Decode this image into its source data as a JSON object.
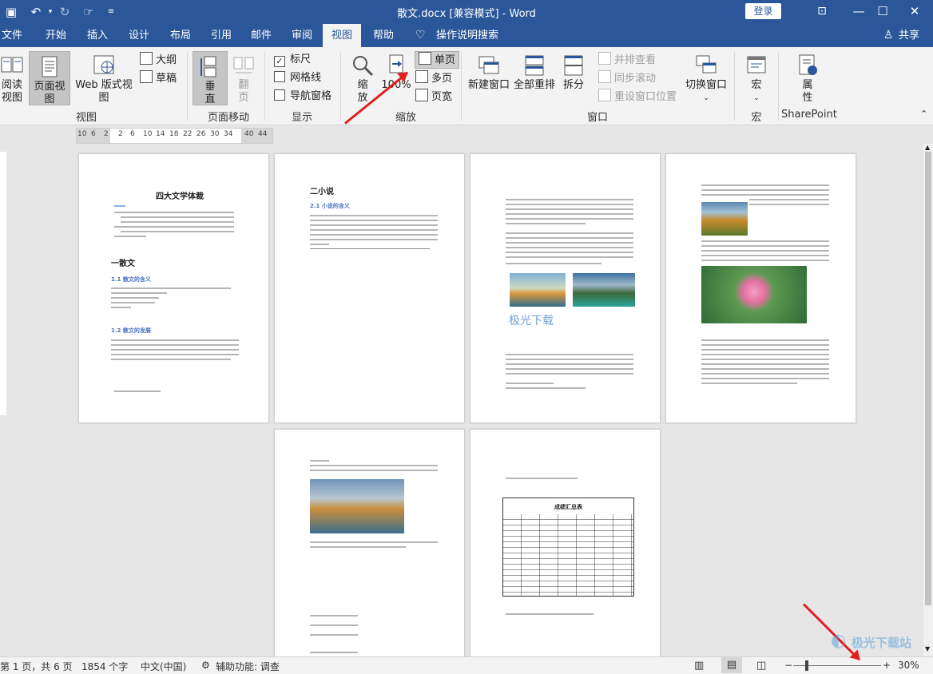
{
  "title_bar": {
    "document_title": "散文.docx [兼容模式]  -  Word",
    "login_label": "登录"
  },
  "tabs": [
    "文件",
    "开始",
    "插入",
    "设计",
    "布局",
    "引用",
    "邮件",
    "审阅",
    "视图",
    "帮助"
  ],
  "active_tab": "视图",
  "tell_me": "操作说明搜索",
  "share_label": "共享",
  "ribbon": {
    "views": {
      "label": "视图",
      "reading_view": "阅读视图",
      "print_layout": "页面视图",
      "web_layout": "Web 版式视图",
      "outline": "大纲",
      "draft": "草稿"
    },
    "page_movement": {
      "label": "页面移动",
      "vertical": "垂直",
      "side_to_side": "翻页"
    },
    "show": {
      "label": "显示",
      "ruler": "标尺",
      "ruler_checked": true,
      "gridlines": "网格线",
      "gridlines_checked": false,
      "navigation_pane": "导航窗格",
      "navigation_checked": false
    },
    "zoom": {
      "label": "缩放",
      "zoom": "缩放",
      "hundred": "100%",
      "one_page": "单页",
      "multiple_pages": "多页",
      "page_width": "页宽"
    },
    "window": {
      "label": "窗口",
      "new_window": "新建窗口",
      "arrange_all": "全部重排",
      "split": "拆分",
      "side_by_side": "并排查看",
      "sync_scroll": "同步滚动",
      "reset_position": "重设窗口位置",
      "switch_windows": "切换窗口"
    },
    "macros": {
      "label": "宏",
      "macros": "宏"
    },
    "sharepoint": {
      "label": "SharePoint",
      "properties": "属性"
    }
  },
  "ruler_ticks": [
    "10",
    "6",
    "2",
    "2",
    "6",
    "10",
    "14",
    "18",
    "22",
    "26",
    "30",
    "34",
    "40",
    "44"
  ],
  "pages": {
    "p1_title": "四大文学体裁",
    "p1_h1": "一散文",
    "p1_h2a": "1.1 散文的含义",
    "p1_h2b": "1.2 散文的发展",
    "p2_title": "二小说",
    "p2_h2": "2.1 小说的含义",
    "p3_caption": "极光下载",
    "p6_table_title": "成绩汇总表"
  },
  "status": {
    "page_info": "第 1 页，共 6 页",
    "word_count": "1854 个字",
    "language": "中文(中国)",
    "accessibility": "辅助功能: 调查",
    "zoom_minus": "−",
    "zoom_plus": "+",
    "zoom_level": "30%"
  },
  "watermark": "极光下载站",
  "accent_color": "#2b579a",
  "arrow_color": "#e02020"
}
